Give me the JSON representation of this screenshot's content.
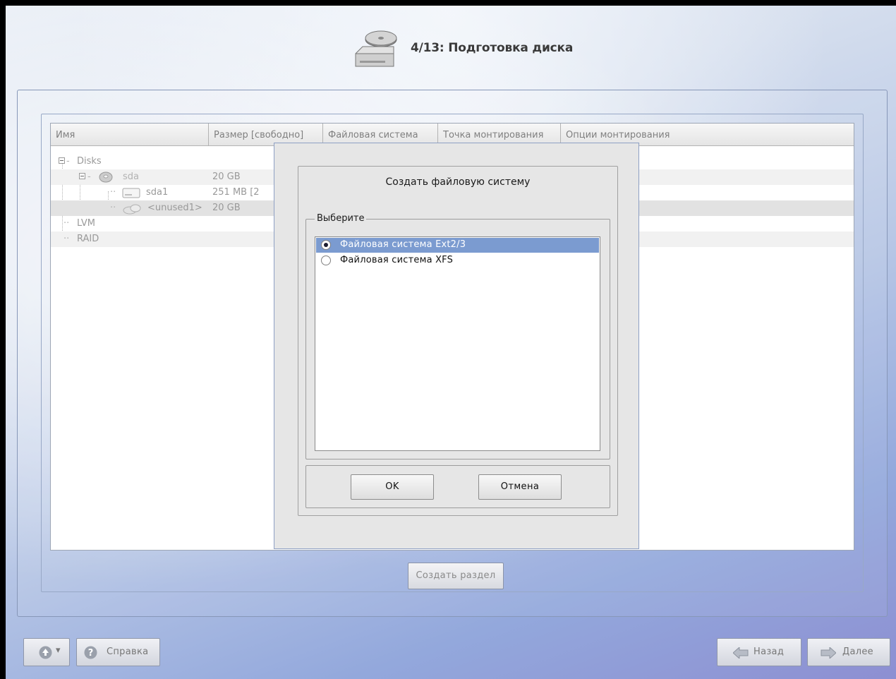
{
  "header": {
    "title": "4/13: Подготовка диска"
  },
  "table": {
    "columns": [
      "Имя",
      "Размер [свободно]",
      "Файловая система",
      "Точка монтирования",
      "Опции монтирования"
    ],
    "rows": [
      {
        "name": "Disks",
        "size": ""
      },
      {
        "name": "sda",
        "size": "20 GB"
      },
      {
        "name": "sda1",
        "size": "251 MB [2"
      },
      {
        "name": "<unused1>",
        "size": "20 GB"
      },
      {
        "name": "LVM",
        "size": ""
      },
      {
        "name": "RAID",
        "size": ""
      }
    ]
  },
  "dialog": {
    "title": "Создать файловую систему",
    "group_label": "Выберите",
    "options": [
      {
        "label": "Файловая система Ext2/3",
        "selected": true
      },
      {
        "label": "Файловая система XFS",
        "selected": false
      }
    ],
    "ok_label": "OK",
    "cancel_label": "Отмена"
  },
  "create_partition_label": "Создать раздел",
  "bottom_bar": {
    "help_label": "Справка",
    "back_label": "Назад",
    "next_label": "Далее"
  },
  "colors": {
    "selection": "#7b9bd0",
    "accent_border": "#8ea0c4"
  },
  "icons": [
    "disk-drive-icon",
    "harddisk-icon",
    "partition-icon",
    "unused-space-icon",
    "up-arrow-icon",
    "help-icon",
    "back-arrow-icon",
    "forward-arrow-icon"
  ]
}
